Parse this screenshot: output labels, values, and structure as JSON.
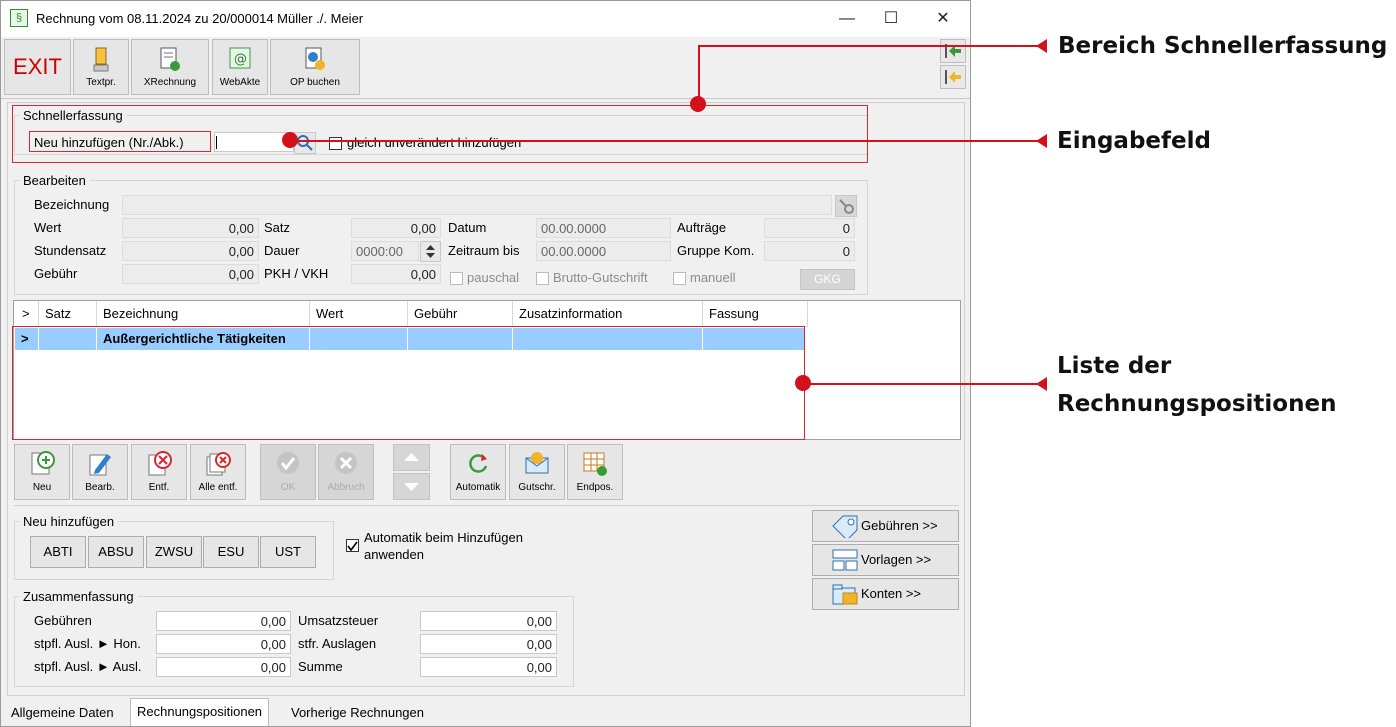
{
  "window": {
    "title": "Rechnung vom 08.11.2024 zu 20/000014  Müller ./. Meier",
    "app_icon": "§"
  },
  "window_controls": {
    "minimize": "—",
    "maximize": "☐",
    "close": "✕"
  },
  "toolbar": {
    "exit": "EXIT",
    "textpr": "Textpr.",
    "xrechnung": "XRechnung",
    "webakte": "WebAkte",
    "op_buchen": "OP buchen"
  },
  "schnellerfassung": {
    "legend": "Schnellerfassung",
    "neu_label": "Neu hinzufügen (Nr./Abk.)",
    "input_value": "",
    "checkbox_label": "gleich unverändert hinzufügen"
  },
  "bearbeiten": {
    "legend": "Bearbeiten",
    "bezeichnung_label": "Bezeichnung",
    "bezeichnung_value": "",
    "wert_label": "Wert",
    "wert_value": "0,00",
    "stundensatz_label": "Stundensatz",
    "stundensatz_value": "0,00",
    "gebuehr_label": "Gebühr",
    "gebuehr_value": "0,00",
    "satz_label": "Satz",
    "satz_value": "0,00",
    "dauer_label": "Dauer",
    "dauer_value": "0000:00",
    "pkh_label": "PKH / VKH",
    "pkh_value": "0,00",
    "datum_label": "Datum",
    "datum_value": "00.00.0000",
    "zeitraum_label": "Zeitraum bis",
    "zeitraum_value": "00.00.0000",
    "auftraege_label": "Aufträge",
    "auftraege_value": "0",
    "gruppe_label": "Gruppe Kom.",
    "gruppe_value": "0",
    "pauschal_label": "pauschal",
    "brutto_label": "Brutto-Gutschrift",
    "manuell_label": "manuell",
    "gkg_label": "GKG"
  },
  "grid": {
    "columns": [
      ">",
      "Satz",
      "Bezeichnung",
      "Wert",
      "Gebühr",
      "Zusatzinformation",
      "Fassung"
    ],
    "rows": [
      {
        "marker": ">",
        "satz": "",
        "bezeichnung": "Außergerichtliche Tätigkeiten",
        "wert": "",
        "gebuehr": "",
        "zusatz": "",
        "fassung": ""
      }
    ]
  },
  "actions": {
    "neu": "Neu",
    "bearb": "Bearb.",
    "entf": "Entf.",
    "alle_entf": "Alle entf.",
    "ok": "OK",
    "abbruch": "Abbruch",
    "automatik": "Automatik",
    "gutschr": "Gutschr.",
    "endpos": "Endpos."
  },
  "neu_hinzufuegen": {
    "legend": "Neu hinzufügen",
    "buttons": [
      "ABTI",
      "ABSU",
      "ZWSU",
      "ESU",
      "UST"
    ],
    "automatik_label_1": "Automatik beim Hinzufügen",
    "automatik_label_2": "anwenden",
    "automatik_checked": true
  },
  "side_buttons": {
    "gebuehren": "Gebühren >>",
    "vorlagen": "Vorlagen >>",
    "konten": "Konten >>"
  },
  "zusammenfassung": {
    "legend": "Zusammenfassung",
    "gebuehren_label": "Gebühren",
    "gebuehren_value": "0,00",
    "stpfl_hon_label": "stpfl. Ausl. ► Hon.",
    "stpfl_hon_value": "0,00",
    "stpfl_ausl_label": "stpfl. Ausl. ► Ausl.",
    "stpfl_ausl_value": "0,00",
    "ust_label": "Umsatzsteuer",
    "ust_value": "0,00",
    "stfr_label": "stfr. Auslagen",
    "stfr_value": "0,00",
    "summe_label": "Summe",
    "summe_value": "0,00"
  },
  "tabs": [
    "Allgemeine Daten",
    "Rechnungspositionen",
    "Vorherige Rechnungen"
  ],
  "annotations": {
    "bereich": "Bereich Schnellerfassung",
    "eingabefeld": "Eingabefeld",
    "liste_1": "Liste der",
    "liste_2": "Rechnungspositionen"
  },
  "colors": {
    "accent_red": "#d3111c",
    "selection": "#99ccff",
    "exit_red": "#d10000"
  }
}
